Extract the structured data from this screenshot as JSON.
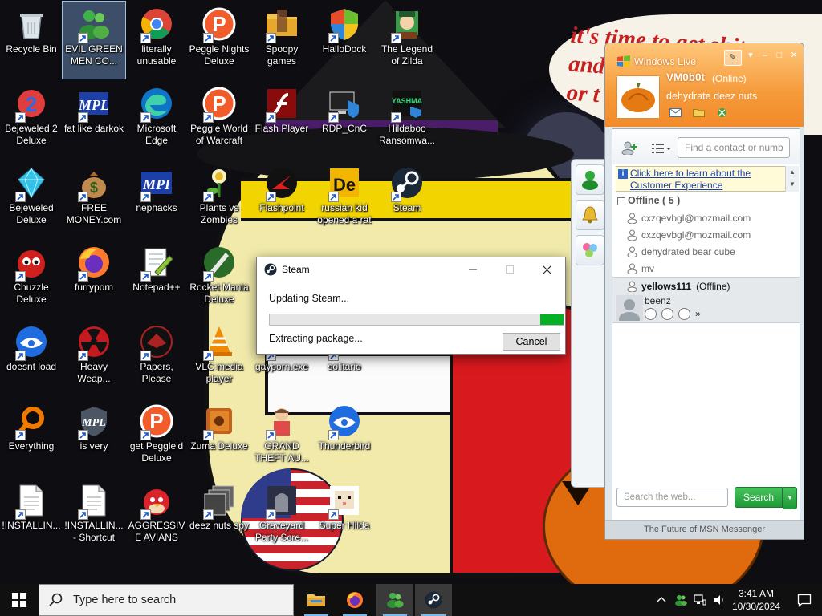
{
  "wallpaper": {
    "speech_text": "it's time to get shit\nand\nor t"
  },
  "desktop": {
    "icons": [
      {
        "label": "Recycle Bin",
        "icon": "recycle-bin-icon"
      },
      {
        "label": "EVIL GREEN MEN CO...",
        "icon": "green-men-icon"
      },
      {
        "label": "literally unusable",
        "icon": "chrome-icon"
      },
      {
        "label": "Peggle Nights Deluxe",
        "icon": "peggle-icon"
      },
      {
        "label": "Spoopy games",
        "icon": "folder-icon"
      },
      {
        "label": "HalloDock",
        "icon": "windows-shield-icon"
      },
      {
        "label": "The Legend of Zilda",
        "icon": "zilda-icon"
      },
      {
        "label": "Bejeweled 2 Deluxe",
        "icon": "bejeweled-2-icon"
      },
      {
        "label": "fat like darkok",
        "icon": "mpl-icon"
      },
      {
        "label": "Microsoft Edge",
        "icon": "edge-icon"
      },
      {
        "label": "Peggle World of Warcraft",
        "icon": "peggle-icon"
      },
      {
        "label": "Flash Player",
        "icon": "flash-icon"
      },
      {
        "label": "RDP_CnC",
        "icon": "rdp-icon"
      },
      {
        "label": "Hildaboo Ransomwa...",
        "icon": "yashma-icon"
      },
      {
        "label": "Bejeweled Deluxe",
        "icon": "gem-icon"
      },
      {
        "label": "FREE MONEY.com",
        "icon": "money-bag-icon"
      },
      {
        "label": "nephacks",
        "icon": "mpi-icon"
      },
      {
        "label": "Plants vs Zombies",
        "icon": "plant-icon"
      },
      {
        "label": "Flashpoint",
        "icon": "flashpoint-icon"
      },
      {
        "label": "russian kid opened a rat",
        "icon": "de-icon"
      },
      {
        "label": "Steam",
        "icon": "steam-icon"
      },
      {
        "label": "Chuzzle Deluxe",
        "icon": "chuzzle-icon"
      },
      {
        "label": "furryporn",
        "icon": "firefox-icon"
      },
      {
        "label": "Notepad++",
        "icon": "notepad-icon"
      },
      {
        "label": "Rocket Mania Deluxe",
        "icon": "rocket-icon"
      },
      {
        "label": "doesnt load",
        "icon": "thunderbird-icon"
      },
      {
        "label": "Heavy Weap...",
        "icon": "radiation-icon"
      },
      {
        "label": "Papers, Please",
        "icon": "papers-please-icon"
      },
      {
        "label": "VLC media player",
        "icon": "vlc-icon"
      },
      {
        "label": "gayporn.exe",
        "icon": "exe-icon"
      },
      {
        "label": "solitario",
        "icon": "cards-icon"
      },
      {
        "label": "Everything",
        "icon": "everything-icon"
      },
      {
        "label": "is very",
        "icon": "mpl-shield-icon"
      },
      {
        "label": "get Peggle'd Deluxe",
        "icon": "peggle-icon"
      },
      {
        "label": "Zuma Deluxe",
        "icon": "zuma-icon"
      },
      {
        "label": "GRAND THEFT AU...",
        "icon": "gta-icon"
      },
      {
        "label": "Thunderbird",
        "icon": "thunderbird-icon"
      },
      {
        "label": "!INSTALLIN...",
        "icon": "document-icon"
      },
      {
        "label": "!INSTALLIN... - Shortcut",
        "icon": "document-icon"
      },
      {
        "label": "AGGRESSIVE AVIANS",
        "icon": "angry-bird-icon"
      },
      {
        "label": "deez nuts spy",
        "icon": "windows-stack-icon"
      },
      {
        "label": "Graveyard Party Scre...",
        "icon": "graveyard-icon"
      },
      {
        "label": "Super Hilda",
        "icon": "pixel-cat-icon"
      }
    ]
  },
  "steam_dialog": {
    "title": "Steam",
    "status": "Updating Steam...",
    "substatus": "Extracting package...",
    "cancel_label": "Cancel",
    "progress": 0.08,
    "accent": "#06b025"
  },
  "msn": {
    "title": "Windows Live",
    "username": "VM0b0t",
    "status": "(Online)",
    "personal_message": "dehydrate deez nuts",
    "search_contacts_placeholder": "Find a contact or number",
    "notice_text": "Click here to learn about the Customer Experience",
    "group_label": "Offline ( 5 )",
    "contacts": [
      "cxzqevbgl@mozmail.com",
      "cxzqevbgl@mozmail.com",
      "dehydrated bear cube",
      "mv"
    ],
    "selected_contact": {
      "name": "yellows111",
      "status": "(Offline)",
      "psm": "beenz",
      "more": "»"
    },
    "web_search_placeholder": "Search the web...",
    "search_button": "Search",
    "footer": "The Future of MSN Messenger",
    "header_color": "#f59a3a"
  },
  "taskbar": {
    "search_placeholder": "Type here to search",
    "apps": [
      "file-explorer-icon",
      "firefox-icon",
      "messenger-icon",
      "steam-icon"
    ],
    "time": "3:41 AM",
    "date": "10/30/2024"
  }
}
